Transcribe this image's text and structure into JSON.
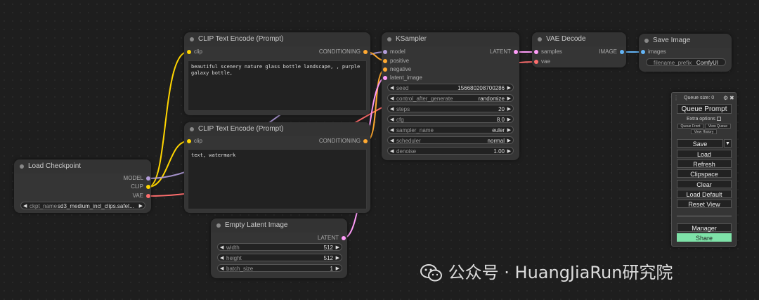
{
  "nodes": {
    "clip_pos": {
      "title": "CLIP Text Encode (Prompt)",
      "in_clip": "clip",
      "out": "CONDITIONING",
      "text": "beautiful scenery nature glass bottle landscape, , purple galaxy bottle,"
    },
    "clip_neg": {
      "title": "CLIP Text Encode (Prompt)",
      "in_clip": "clip",
      "out": "CONDITIONING",
      "text": "text, watermark"
    },
    "ksampler": {
      "title": "KSampler",
      "inputs": [
        "model",
        "positive",
        "negative",
        "latent_image"
      ],
      "out": "LATENT",
      "widgets": [
        {
          "label": "seed",
          "value": "156680208700286"
        },
        {
          "label": "control_after_generate",
          "value": "randomize"
        },
        {
          "label": "steps",
          "value": "20"
        },
        {
          "label": "cfg",
          "value": "8.0"
        },
        {
          "label": "sampler_name",
          "value": "euler"
        },
        {
          "label": "scheduler",
          "value": "normal"
        },
        {
          "label": "denoise",
          "value": "1.00"
        }
      ]
    },
    "vae_decode": {
      "title": "VAE Decode",
      "in_samples": "samples",
      "in_vae": "vae",
      "out": "IMAGE"
    },
    "save_image": {
      "title": "Save Image",
      "in_images": "images",
      "w_label": "filename_prefix",
      "w_value": "ComfyUI"
    },
    "load_ckpt": {
      "title": "Load Checkpoint",
      "out_model": "MODEL",
      "out_clip": "CLIP",
      "out_vae": "VAE",
      "w_label": "ckpt_name",
      "w_value": "sd3_medium_incl_clips.safet..."
    },
    "empty_latent": {
      "title": "Empty Latent Image",
      "out": "LATENT",
      "widgets": [
        {
          "label": "width",
          "value": "512"
        },
        {
          "label": "height",
          "value": "512"
        },
        {
          "label": "batch_size",
          "value": "1"
        }
      ]
    }
  },
  "panel": {
    "queue_size": "Queue size: 0",
    "queue_prompt": "Queue Prompt",
    "extra_options": "Extra options",
    "queue_front": "Queue Front",
    "view_queue": "View Queue",
    "view_history": "View History",
    "save": "Save",
    "load": "Load",
    "refresh": "Refresh",
    "clipspace": "Clipspace",
    "clear": "Clear",
    "load_default": "Load Default",
    "reset_view": "Reset View",
    "manager": "Manager",
    "share": "Share"
  },
  "watermark": "公众号 · HuangJiaRun研究院",
  "colors": {
    "model": "#b39ddb",
    "clip": "#ffd500",
    "vae": "#ff6e6e",
    "conditioning": "#ffa931",
    "latent": "#ff9cf9",
    "image": "#64b5f6",
    "share": "#7ee2a8"
  }
}
